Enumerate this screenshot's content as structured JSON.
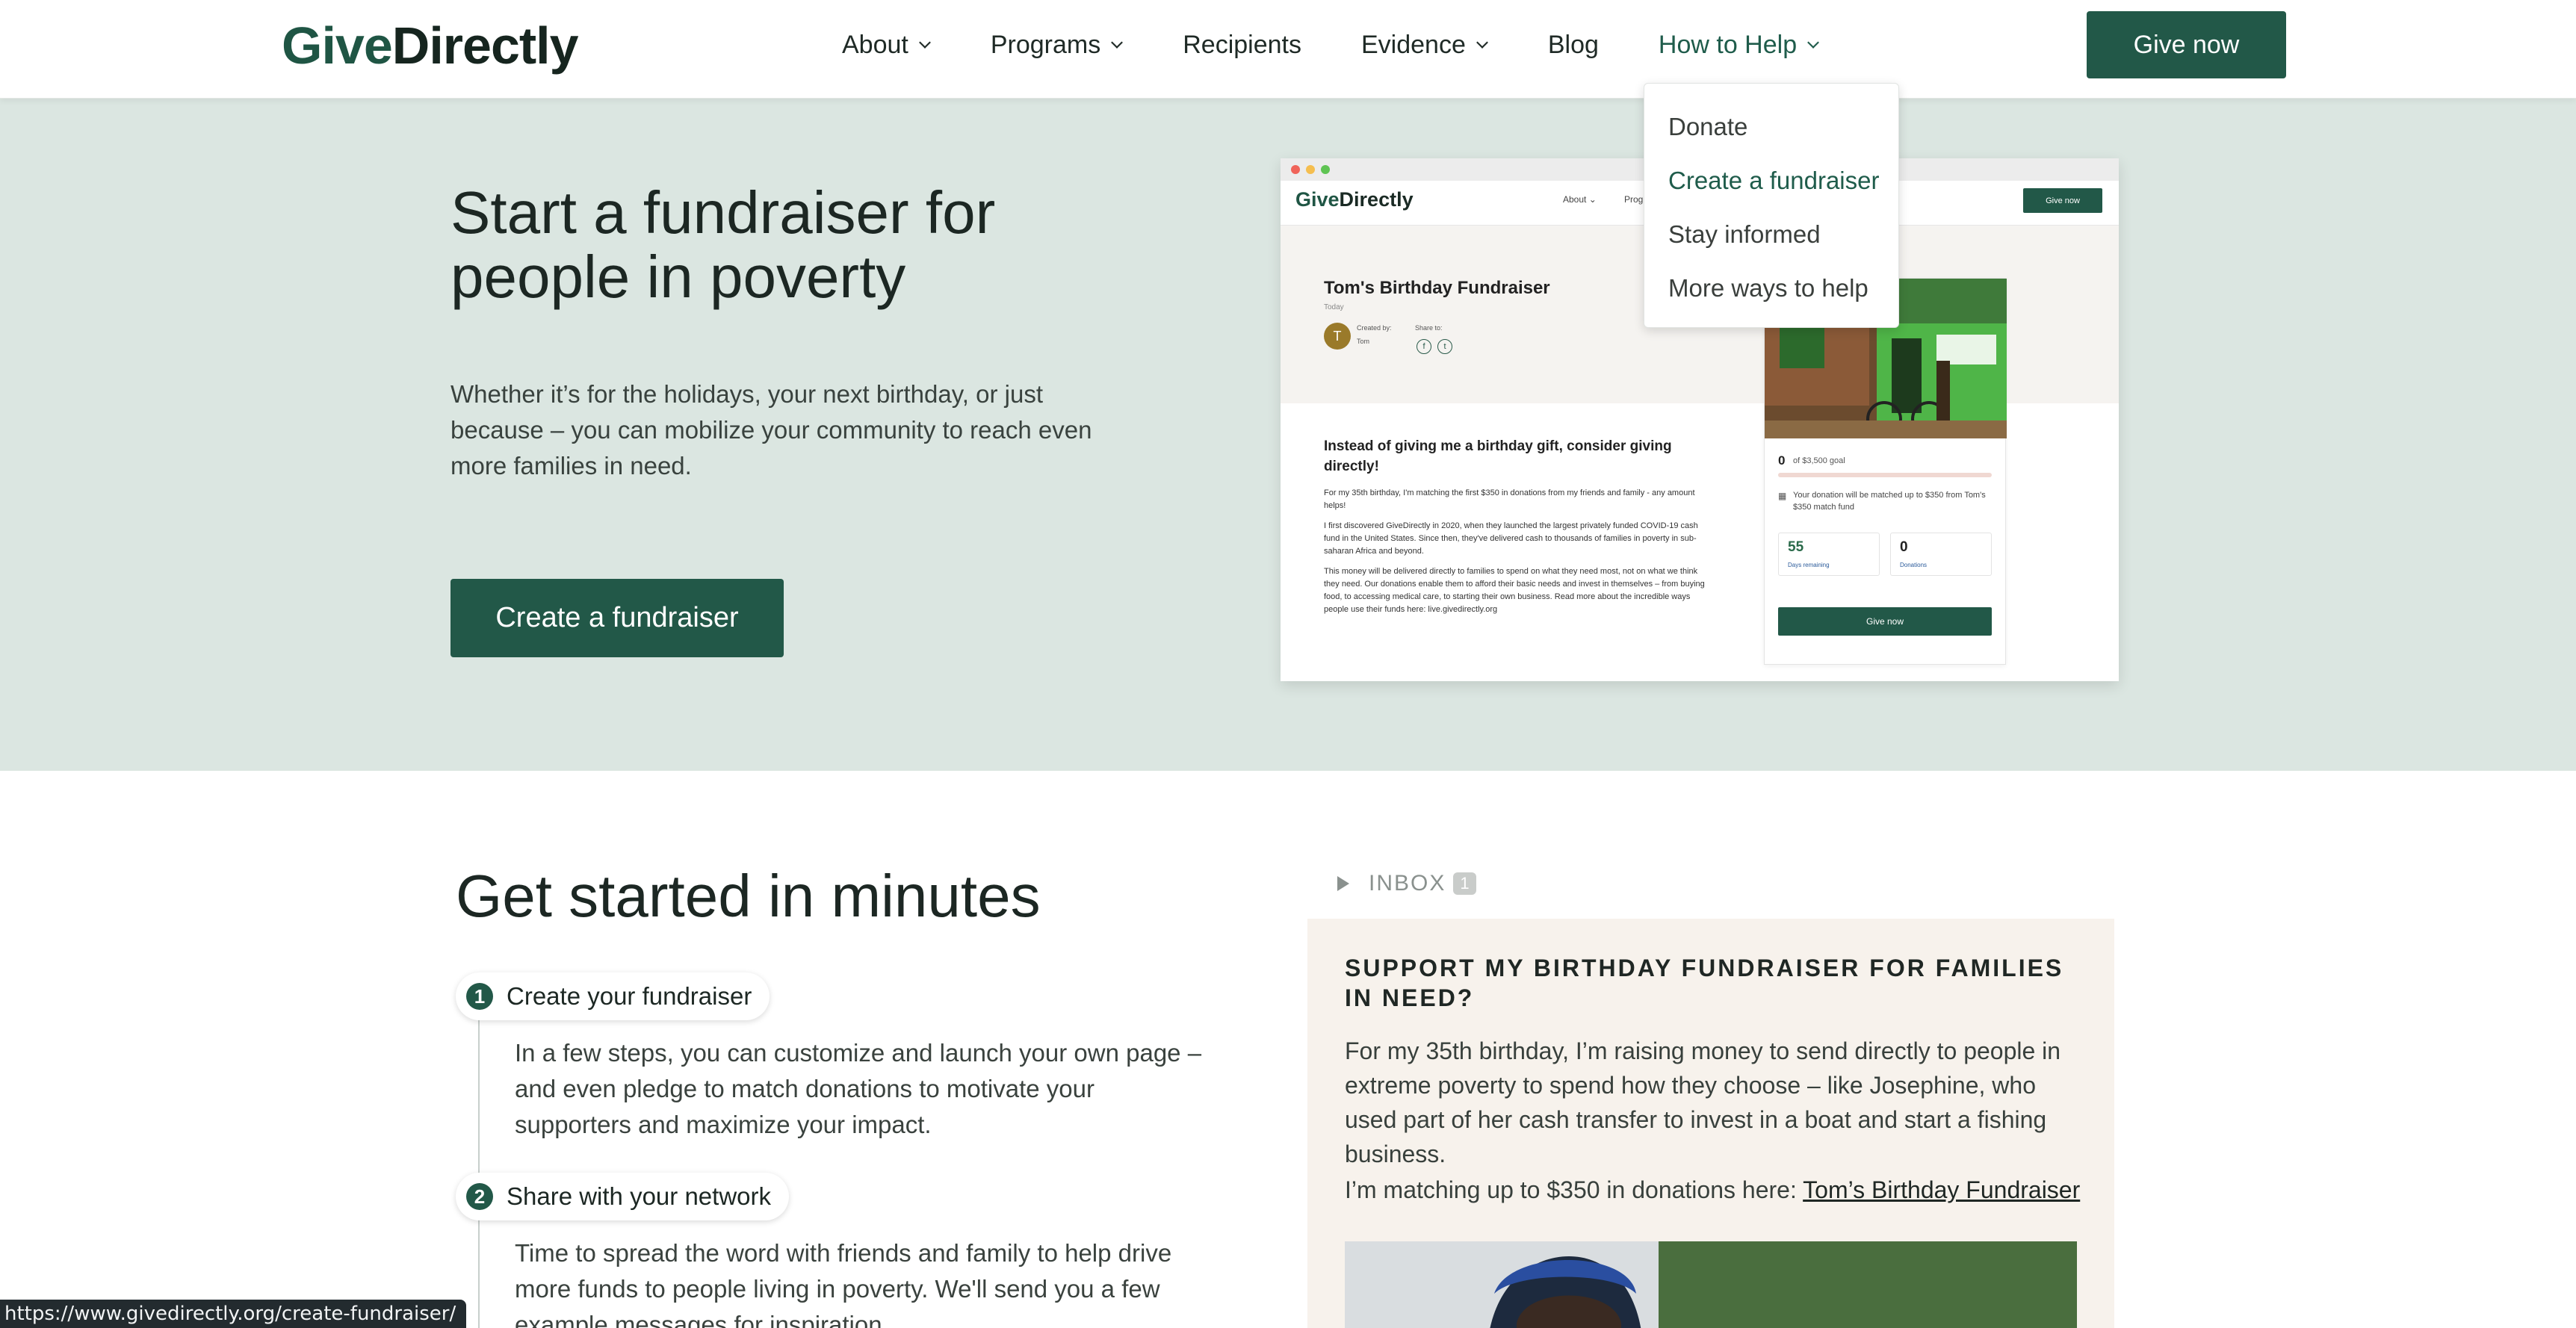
{
  "header": {
    "logo_give": "Give",
    "logo_directly": "Directly",
    "nav": [
      {
        "label": "About"
      },
      {
        "label": "Programs"
      },
      {
        "label": "Recipients"
      },
      {
        "label": "Evidence"
      },
      {
        "label": "Blog"
      },
      {
        "label": "How to Help"
      }
    ],
    "give_now": "Give now",
    "accent_color": "#225848"
  },
  "dropdown": {
    "items": [
      "Donate",
      "Create a fundraiser",
      "Stay informed",
      "More ways to help"
    ]
  },
  "hero": {
    "title": "Start a fundraiser for people in poverty",
    "description": "Whether it’s for the holidays, your next birthday, or just because – you can mobilize your community to reach even more families in need.",
    "button": "Create a fundraiser",
    "background": "#dbe6e1"
  },
  "mockup": {
    "logo_give": "Give",
    "logo_directly": "Directly",
    "nav_about": "About ⌄",
    "nav_programs": "Prog",
    "give_now": "Give now",
    "title": "Tom's Birthday Fundraiser",
    "date": "Today",
    "avatar_initial": "T",
    "created_by": "Created by:",
    "creator": "Tom",
    "share_to": "Share to:",
    "heading": "Instead of giving me a birthday gift, consider giving directly!",
    "paragraphs": [
      "For my 35th birthday, I'm matching the first $350 in donations from my friends and family - any amount helps!",
      "I first discovered GiveDirectly in 2020, when they launched the largest privately funded COVID-19 cash fund in the United States. Since then, they've delivered cash to thousands of families in poverty in sub-saharan Africa and beyond.",
      "This money will be delivered directly to families to spend on what they need most, not on what we think they need. Our donations enable them to afford their basic needs and invest in themselves – from buying food, to accessing medical care, to starting their own business. Read more about the incredible ways people use their funds here: live.givedirectly.org"
    ],
    "amount": "0",
    "goal": "of $3,500 goal",
    "match_note": "Your donation will be matched up to $350 from Tom's $350 match fund",
    "days_value": "55",
    "days_label": "Days remaining",
    "donations_value": "0",
    "donations_label": "Donations",
    "card_give_now": "Give now"
  },
  "get_started": {
    "title": "Get started in minutes",
    "steps": [
      {
        "num": "1",
        "label": "Create your fundraiser",
        "desc": "In a few steps, you can customize and launch your own page – and even pledge to match donations to motivate your supporters and maximize your impact."
      },
      {
        "num": "2",
        "label": "Share with your network",
        "desc": "Time to spread the word with friends and family to help drive more funds to people living in poverty. We'll send you a few example messages for inspiration."
      }
    ]
  },
  "email": {
    "inbox_label": "INBOX",
    "inbox_count": "1",
    "subject": "SUPPORT MY BIRTHDAY FUNDRAISER FOR FAMILIES IN NEED?",
    "body": "For my 35th birthday, I’m raising money to send directly to people in extreme poverty to spend how they choose – like Josephine, who used part of her cash transfer to invest in a boat and start a fishing business.",
    "matching_text": "I’m matching up to $350 in donations here: ",
    "link_text": "Tom’s Birthday Fundraiser"
  },
  "status_bar": {
    "url": "https://www.givedirectly.org/create-fundraiser/"
  }
}
